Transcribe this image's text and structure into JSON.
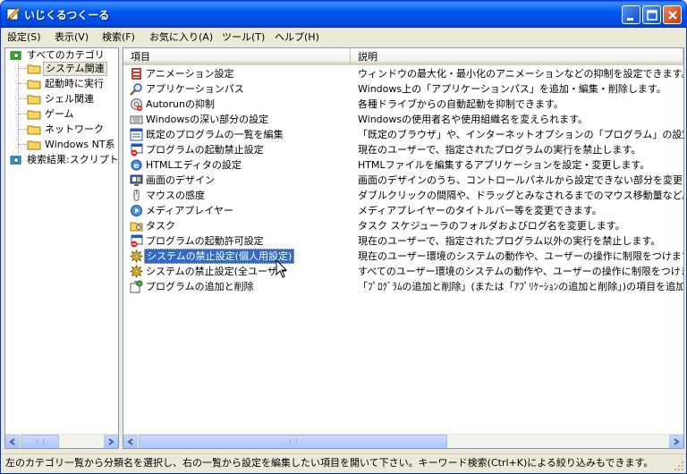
{
  "window": {
    "title": "いじくるつくーる"
  },
  "menu": [
    "設定(S)",
    "表示(V)",
    "検索(F)",
    "お気に入り(A)",
    "ツール(T)",
    "ヘルプ(H)"
  ],
  "tree": {
    "root": "すべてのカテゴリ",
    "children": [
      "システム関連",
      "起動時に実行",
      "シェル関連",
      "ゲーム",
      "ネットワーク",
      "Windows NT系"
    ],
    "search": "検索結果:スクリプト検"
  },
  "columns": {
    "item": "項目",
    "description": "説明"
  },
  "rows": [
    {
      "name": "アニメーション設定",
      "desc": "ウィンドウの最大化・最小化のアニメーションなどの抑制を設定できます。",
      "icon": "animation-icon"
    },
    {
      "name": "アプリケーションパス",
      "desc": "Windows上の「アプリケーションパス」を追加・編集・削除します。",
      "icon": "magnifier-icon"
    },
    {
      "name": "Autorunの抑制",
      "desc": "各種ドライブからの自動起動を抑制できます。",
      "icon": "cd-icon"
    },
    {
      "name": "Windowsの深い部分の設定",
      "desc": "Windowsの使用者名や使用組織名を変えられます。",
      "icon": "keyboard-icon"
    },
    {
      "name": "既定のプログラムの一覧を編集",
      "desc": "「既定のブラウザ」や、インターネットオプションの「プログラム」の設定で選択できるプ",
      "icon": "program-list-icon"
    },
    {
      "name": "プログラムの起動禁止設定",
      "desc": "現在のユーザーで、指定されたプログラムの実行を禁止します。",
      "icon": "blocked-window-icon"
    },
    {
      "name": "HTMLエディタの設定",
      "desc": "HTMLファイルを編集するアプリケーションを設定・変更します。",
      "icon": "ie-icon"
    },
    {
      "name": "画面のデザイン",
      "desc": "画面のデザインのうち、コントロールパネルから設定できない部分を変更します。",
      "icon": "display-icon"
    },
    {
      "name": "マウスの感度",
      "desc": "ダブルクリックの間隔や、ドラッグとみなされるまでのマウス移動量など。",
      "icon": "mouse-icon"
    },
    {
      "name": "メディアプレイヤー",
      "desc": "メディアプレイヤーのタイトルバー等を変更できます。",
      "icon": "media-player-icon"
    },
    {
      "name": "タスク",
      "desc": "タスク スケジューラのフォルダおよびログ名を変更します。",
      "icon": "task-folder-icon"
    },
    {
      "name": "プログラムの起動許可設定",
      "desc": "現在のユーザーで、指定されたプログラム以外の実行を禁止します。",
      "icon": "blocked-window-icon"
    },
    {
      "name": "システムの禁止設定(個人用設定)",
      "desc": "現在のユーザー環境のシステムの動作や、ユーザーの操作に制限をつけます。",
      "icon": "gear-icon",
      "selected": true
    },
    {
      "name": "システムの禁止設定(全ユーザー",
      "desc": "すべてのユーザー環境のシステムの動作や、ユーザーの操作に制限をつけます。",
      "icon": "gear-icon"
    },
    {
      "name": "プログラムの追加と削除",
      "desc": "「ﾌﾟﾛｸﾞﾗﾑの追加と削除」(または「ｱﾌﾟﾘｹｰｼｮﾝの追加と削除」)の項目を追加・編",
      "icon": "add-remove-icon"
    }
  ],
  "status": "左のカテゴリ一覧から分類名を選択し、右の一覧から設定を編集したい項目を開いて下さい。キーワード検索(Ctrl+K)による絞り込みもできます。"
}
